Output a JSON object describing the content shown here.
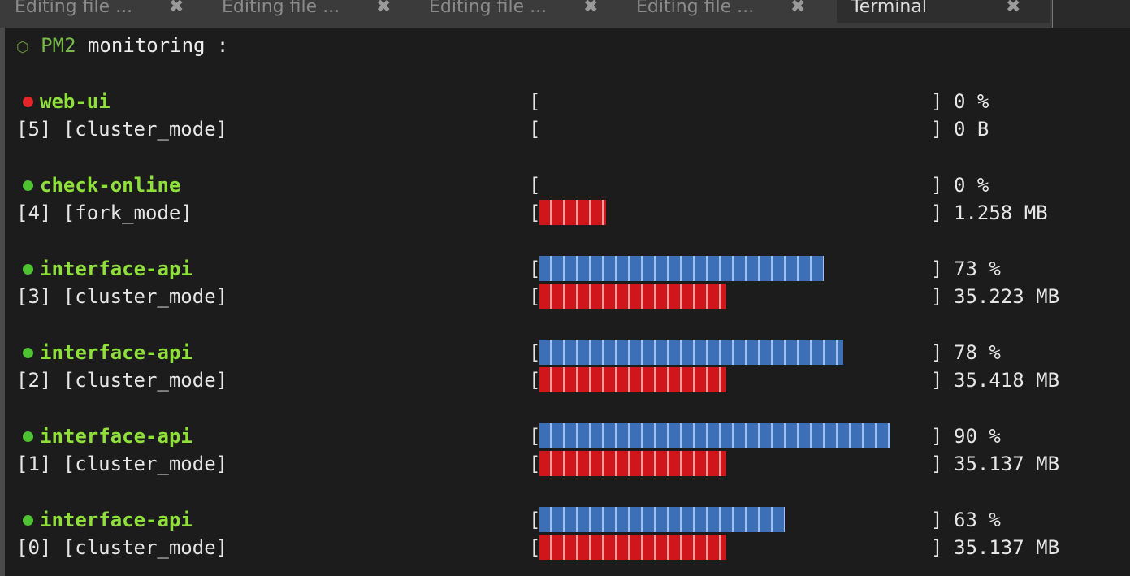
{
  "tabs": [
    {
      "label": "Editing file ...",
      "close": "✖"
    },
    {
      "label": "Editing file ...",
      "close": "✖"
    },
    {
      "label": "Editing file ...",
      "close": "✖"
    },
    {
      "label": "Editing file ...",
      "close": "✖"
    },
    {
      "label": "Terminal",
      "close": "✖"
    }
  ],
  "header": {
    "icon": "⬡",
    "app": "PM2",
    "title": "monitoring :"
  },
  "processes": [
    {
      "status_color": "#e2262b",
      "name": "web-ui",
      "id_mode": "[5] [cluster_mode]",
      "cpu_fill": 0,
      "mem_fill": 0,
      "cpu_text": "0 %",
      "mem_text": "0 B"
    },
    {
      "status_color": "#4fc234",
      "name": "check-online",
      "id_mode": "[4] [fork_mode]",
      "cpu_fill": 0,
      "mem_fill": 0.17,
      "cpu_text": "0 %",
      "mem_text": "1.258 MB"
    },
    {
      "status_color": "#4fc234",
      "name": "interface-api",
      "id_mode": "[3] [cluster_mode]",
      "cpu_fill": 0.73,
      "mem_fill": 0.48,
      "cpu_text": "73 %",
      "mem_text": "35.223 MB"
    },
    {
      "status_color": "#4fc234",
      "name": "interface-api",
      "id_mode": "[2] [cluster_mode]",
      "cpu_fill": 0.78,
      "mem_fill": 0.48,
      "cpu_text": "78 %",
      "mem_text": "35.418 MB"
    },
    {
      "status_color": "#4fc234",
      "name": "interface-api",
      "id_mode": "[1] [cluster_mode]",
      "cpu_fill": 0.9,
      "mem_fill": 0.48,
      "cpu_text": "90 %",
      "mem_text": "35.137 MB"
    },
    {
      "status_color": "#4fc234",
      "name": "interface-api",
      "id_mode": "[0] [cluster_mode]",
      "cpu_fill": 0.63,
      "mem_fill": 0.48,
      "cpu_text": "63 %",
      "mem_text": "35.137 MB"
    }
  ]
}
